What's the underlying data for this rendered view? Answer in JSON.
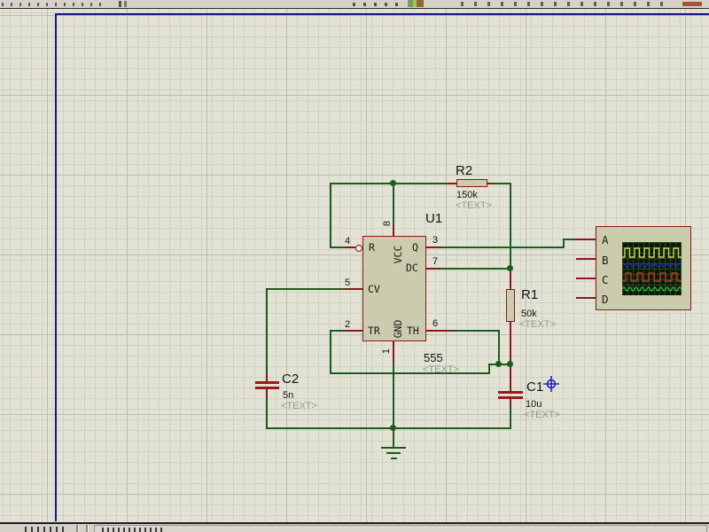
{
  "components": {
    "u1": {
      "designator": "U1",
      "part": "555",
      "placeholder": "<TEXT>",
      "pins": {
        "r": {
          "num": "4",
          "name": "R"
        },
        "cv": {
          "num": "5",
          "name": "CV"
        },
        "tr": {
          "num": "2",
          "name": "TR"
        },
        "q": {
          "num": "3",
          "name": "Q"
        },
        "dc": {
          "num": "7",
          "name": "DC"
        },
        "th": {
          "num": "6",
          "name": "TH"
        },
        "vcc": {
          "num": "8",
          "name": "VCC"
        },
        "gnd": {
          "num": "1",
          "name": "GND"
        }
      }
    },
    "r2": {
      "designator": "R2",
      "value": "150k",
      "placeholder": "<TEXT>"
    },
    "r1": {
      "designator": "R1",
      "value": "50k",
      "placeholder": "<TEXT>"
    },
    "c2": {
      "designator": "C2",
      "value": "5n",
      "placeholder": "<TEXT>"
    },
    "c1": {
      "designator": "C1",
      "value": "10u",
      "placeholder": "<TEXT>"
    },
    "scope": {
      "channels": [
        "A",
        "B",
        "C",
        "D"
      ]
    }
  },
  "colors": {
    "canvas_bg": "#e3e3d5",
    "grid_minor": "#d2d2c2",
    "grid_major": "#bdbdad",
    "sheet_border": "#16168c",
    "wire": "#1b5e1b",
    "pin_stub": "#8c1717",
    "component_fill": "#cbcbae",
    "component_border": "#8c1717",
    "scope_screen_bg": "#0b1a07",
    "trace_a": "#d8d846",
    "trace_b": "#2a2ac8",
    "trace_c": "#c23420",
    "trace_d": "#34c24a",
    "origin_marker": "#2222cc"
  }
}
